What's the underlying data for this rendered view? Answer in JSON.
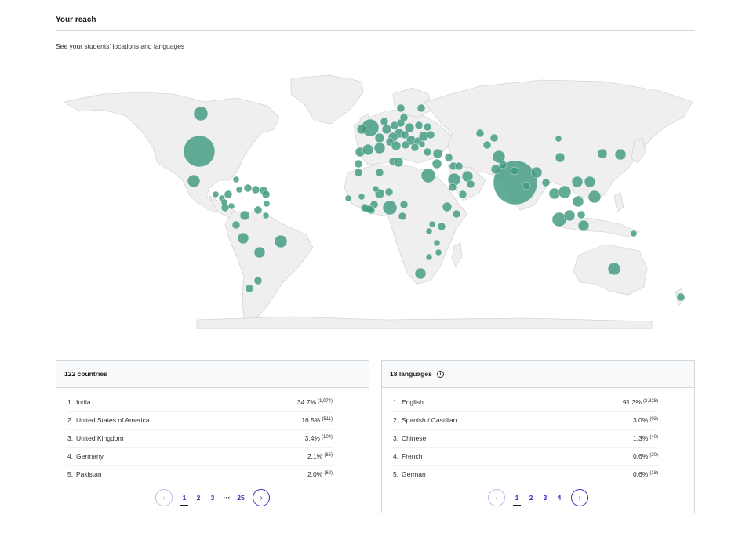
{
  "section": {
    "title": "Your reach",
    "subtitle": "See your students' locations and languages"
  },
  "colors": {
    "bubble": "#3f9a80",
    "land": "#efeff0",
    "accent": "#5022c3"
  },
  "countries": {
    "header": "122 countries",
    "rows": [
      {
        "rank": "1.",
        "name": "India",
        "pct": "34.7%",
        "count": "(1,074)"
      },
      {
        "rank": "2.",
        "name": "United States of America",
        "pct": "16.5%",
        "count": "(511)"
      },
      {
        "rank": "3.",
        "name": "United Kingdom",
        "pct": "3.4%",
        "count": "(104)"
      },
      {
        "rank": "4.",
        "name": "Germany",
        "pct": "2.1%",
        "count": "(65)"
      },
      {
        "rank": "5.",
        "name": "Pakistan",
        "pct": "2.0%",
        "count": "(62)"
      }
    ],
    "pages": [
      "1",
      "2",
      "3",
      "25"
    ],
    "ellipsis": "···",
    "prev_icon": "‹",
    "next_icon": "›"
  },
  "languages": {
    "header": "18 languages",
    "info_icon": "i",
    "rows": [
      {
        "rank": "1.",
        "name": "English",
        "pct": "91.3%",
        "count": "(2,828)"
      },
      {
        "rank": "2.",
        "name": "Spanish / Castilian",
        "pct": "3.0%",
        "count": "(93)"
      },
      {
        "rank": "3.",
        "name": "Chinese",
        "pct": "1.3%",
        "count": "(40)"
      },
      {
        "rank": "4.",
        "name": "French",
        "pct": "0.6%",
        "count": "(20)"
      },
      {
        "rank": "5.",
        "name": "German",
        "pct": "0.6%",
        "count": "(18)"
      }
    ],
    "pages": [
      "1",
      "2",
      "3",
      "4"
    ],
    "prev_icon": "‹",
    "next_icon": "›"
  }
}
